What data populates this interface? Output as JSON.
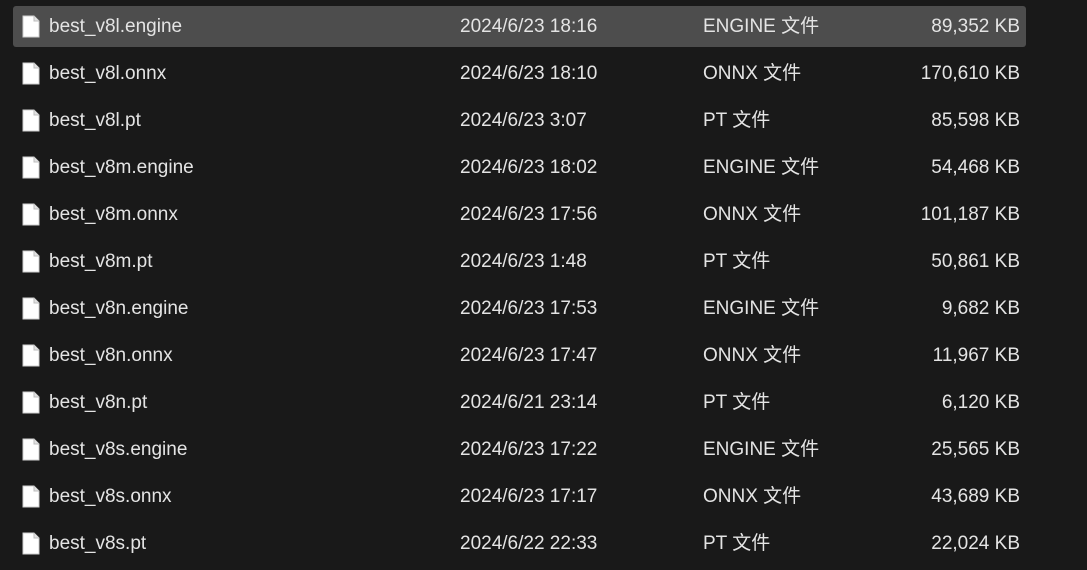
{
  "files": [
    {
      "name": "best_v8l.engine",
      "date": "2024/6/23 18:16",
      "type": "ENGINE 文件",
      "size": "89,352 KB",
      "selected": true
    },
    {
      "name": "best_v8l.onnx",
      "date": "2024/6/23 18:10",
      "type": "ONNX 文件",
      "size": "170,610 KB",
      "selected": false
    },
    {
      "name": "best_v8l.pt",
      "date": "2024/6/23 3:07",
      "type": "PT 文件",
      "size": "85,598 KB",
      "selected": false
    },
    {
      "name": "best_v8m.engine",
      "date": "2024/6/23 18:02",
      "type": "ENGINE 文件",
      "size": "54,468 KB",
      "selected": false
    },
    {
      "name": "best_v8m.onnx",
      "date": "2024/6/23 17:56",
      "type": "ONNX 文件",
      "size": "101,187 KB",
      "selected": false
    },
    {
      "name": "best_v8m.pt",
      "date": "2024/6/23 1:48",
      "type": "PT 文件",
      "size": "50,861 KB",
      "selected": false
    },
    {
      "name": "best_v8n.engine",
      "date": "2024/6/23 17:53",
      "type": "ENGINE 文件",
      "size": "9,682 KB",
      "selected": false
    },
    {
      "name": "best_v8n.onnx",
      "date": "2024/6/23 17:47",
      "type": "ONNX 文件",
      "size": "11,967 KB",
      "selected": false
    },
    {
      "name": "best_v8n.pt",
      "date": "2024/6/21 23:14",
      "type": "PT 文件",
      "size": "6,120 KB",
      "selected": false
    },
    {
      "name": "best_v8s.engine",
      "date": "2024/6/23 17:22",
      "type": "ENGINE 文件",
      "size": "25,565 KB",
      "selected": false
    },
    {
      "name": "best_v8s.onnx",
      "date": "2024/6/23 17:17",
      "type": "ONNX 文件",
      "size": "43,689 KB",
      "selected": false
    },
    {
      "name": "best_v8s.pt",
      "date": "2024/6/22 22:33",
      "type": "PT 文件",
      "size": "22,024 KB",
      "selected": false
    }
  ],
  "icon": "file-icon",
  "colors": {
    "background": "#191919",
    "selected_row": "#4d4d4d",
    "text": "#e4e4e4"
  }
}
